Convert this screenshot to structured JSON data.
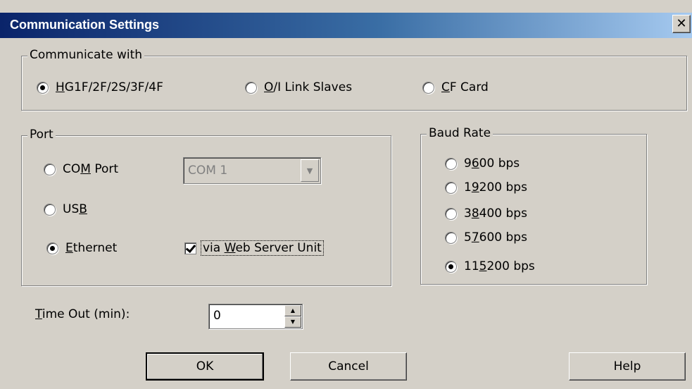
{
  "window": {
    "title": "Communication Settings",
    "close_glyph": "✕"
  },
  "communicate_with": {
    "legend": "Communicate with",
    "options": [
      {
        "pre": "",
        "ul": "H",
        "post": "G1F/2F/2S/3F/4F",
        "checked": true
      },
      {
        "pre": "",
        "ul": "O",
        "post": "/I Link Slaves",
        "checked": false
      },
      {
        "pre": "",
        "ul": "C",
        "post": "F Card",
        "checked": false
      }
    ]
  },
  "port": {
    "legend": "Port",
    "com": {
      "pre": "CO",
      "ul": "M",
      "post": " Port",
      "checked": false
    },
    "usb": {
      "pre": "US",
      "ul": "B",
      "post": "",
      "checked": false
    },
    "ethernet": {
      "pre": "",
      "ul": "E",
      "post": "thernet",
      "checked": true
    },
    "com_select_value": "COM 1",
    "via_web": {
      "pre": "via ",
      "ul": "W",
      "post": "eb Server Unit",
      "checked": true
    }
  },
  "baud_rate": {
    "legend": "Baud Rate",
    "options": [
      {
        "pre": "9",
        "ul": "6",
        "post": "00 bps",
        "checked": false
      },
      {
        "pre": "1",
        "ul": "9",
        "post": "200 bps",
        "checked": false
      },
      {
        "pre": "3",
        "ul": "8",
        "post": "400 bps",
        "checked": false
      },
      {
        "pre": "5",
        "ul": "7",
        "post": "600 bps",
        "checked": false
      },
      {
        "pre": "11",
        "ul": "5",
        "post": "200 bps",
        "checked": true
      }
    ]
  },
  "timeout": {
    "pre": "",
    "ul": "T",
    "post": "ime Out (min):",
    "value": "0"
  },
  "buttons": {
    "ok": "OK",
    "cancel": "Cancel",
    "help": "Help"
  }
}
